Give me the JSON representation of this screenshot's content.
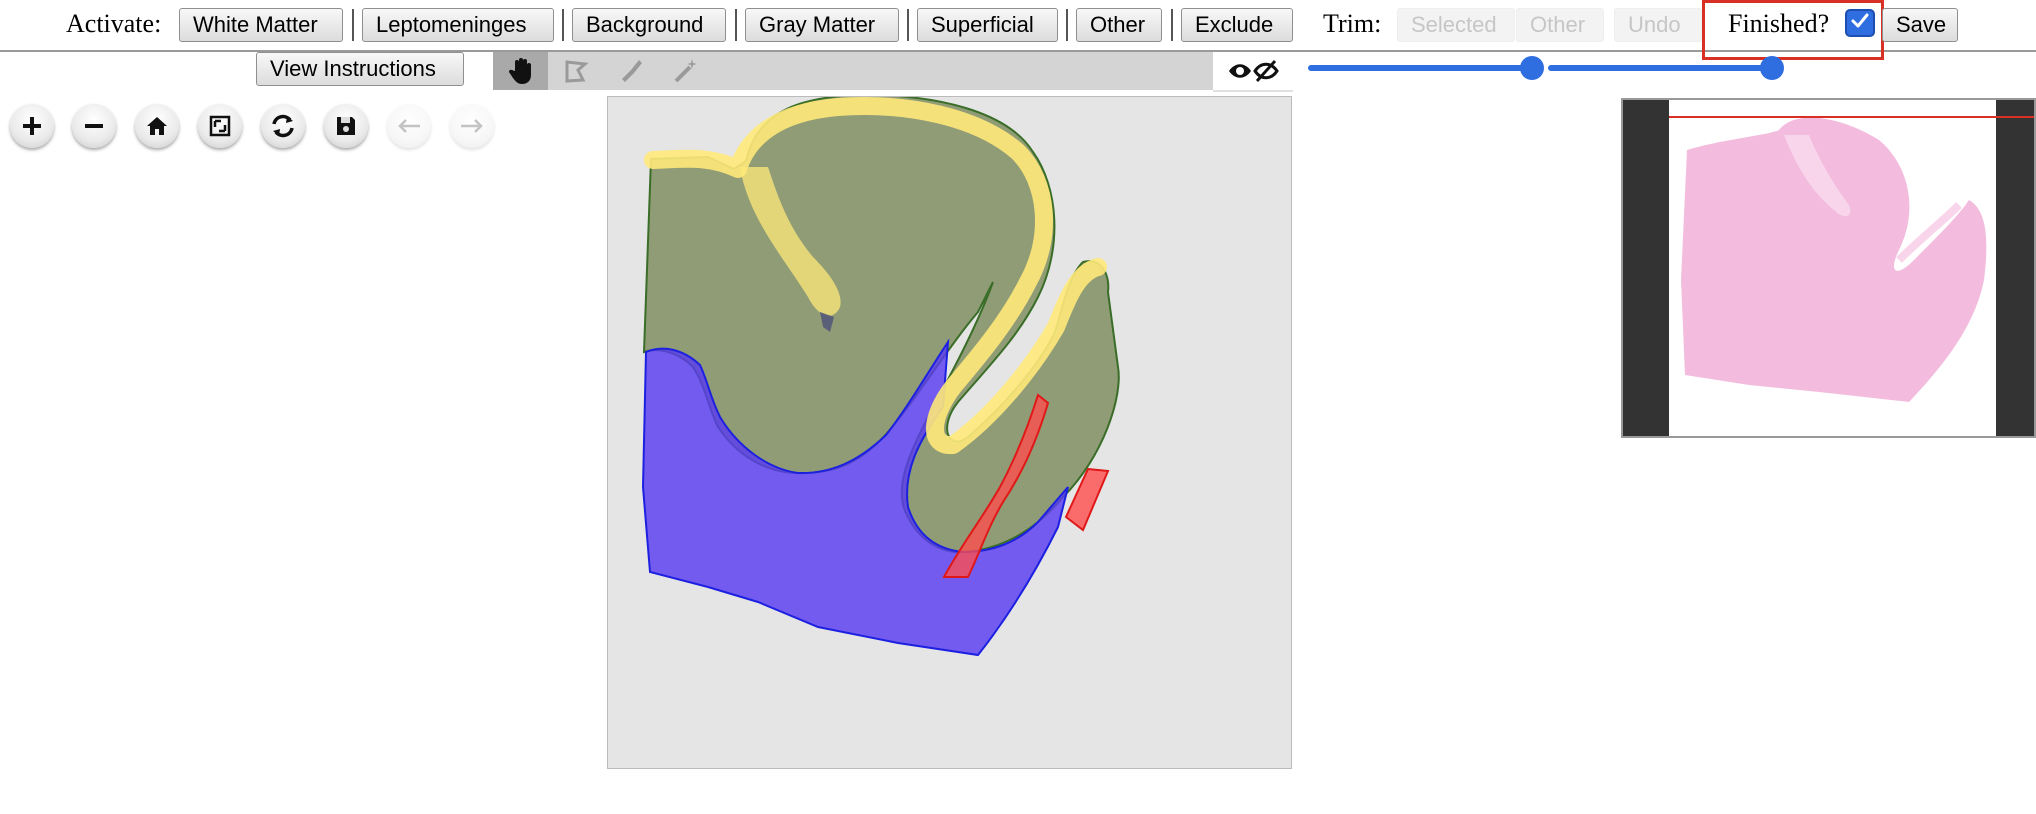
{
  "toolbar": {
    "activate_label": "Activate:",
    "class_buttons": [
      "White Matter",
      "Leptomeninges",
      "Background",
      "Gray Matter",
      "Superficial",
      "Other",
      "Exclude"
    ],
    "trim_label": "Trim:",
    "trim_buttons": [
      "Selected",
      "Other"
    ],
    "undo_label": "Undo",
    "finished_label": "Finished?",
    "finished_checked": true,
    "save_label": "Save"
  },
  "secondary": {
    "view_instructions_label": "View Instructions",
    "tools": [
      "pan-hand-icon",
      "polygon-icon",
      "brush-icon",
      "magic-wand-icon"
    ],
    "active_tool": "pan-hand-icon",
    "visibility_icon": "eye-toggle-icon"
  },
  "navigation": {
    "buttons": [
      "zoom-in-icon",
      "zoom-out-icon",
      "home-icon",
      "fullscreen-icon",
      "rotate-icon",
      "save-icon",
      "previous-icon",
      "next-icon"
    ]
  },
  "colors": {
    "accent": "#2f6ee0",
    "white_matter": "#5a3cf0",
    "gray_matter": "#6e7f4a",
    "leptomeninges": "#ffe97a",
    "exclude": "#ff4d4d",
    "tissue_pink": "#f2b8dc",
    "highlight": "#d93025"
  }
}
